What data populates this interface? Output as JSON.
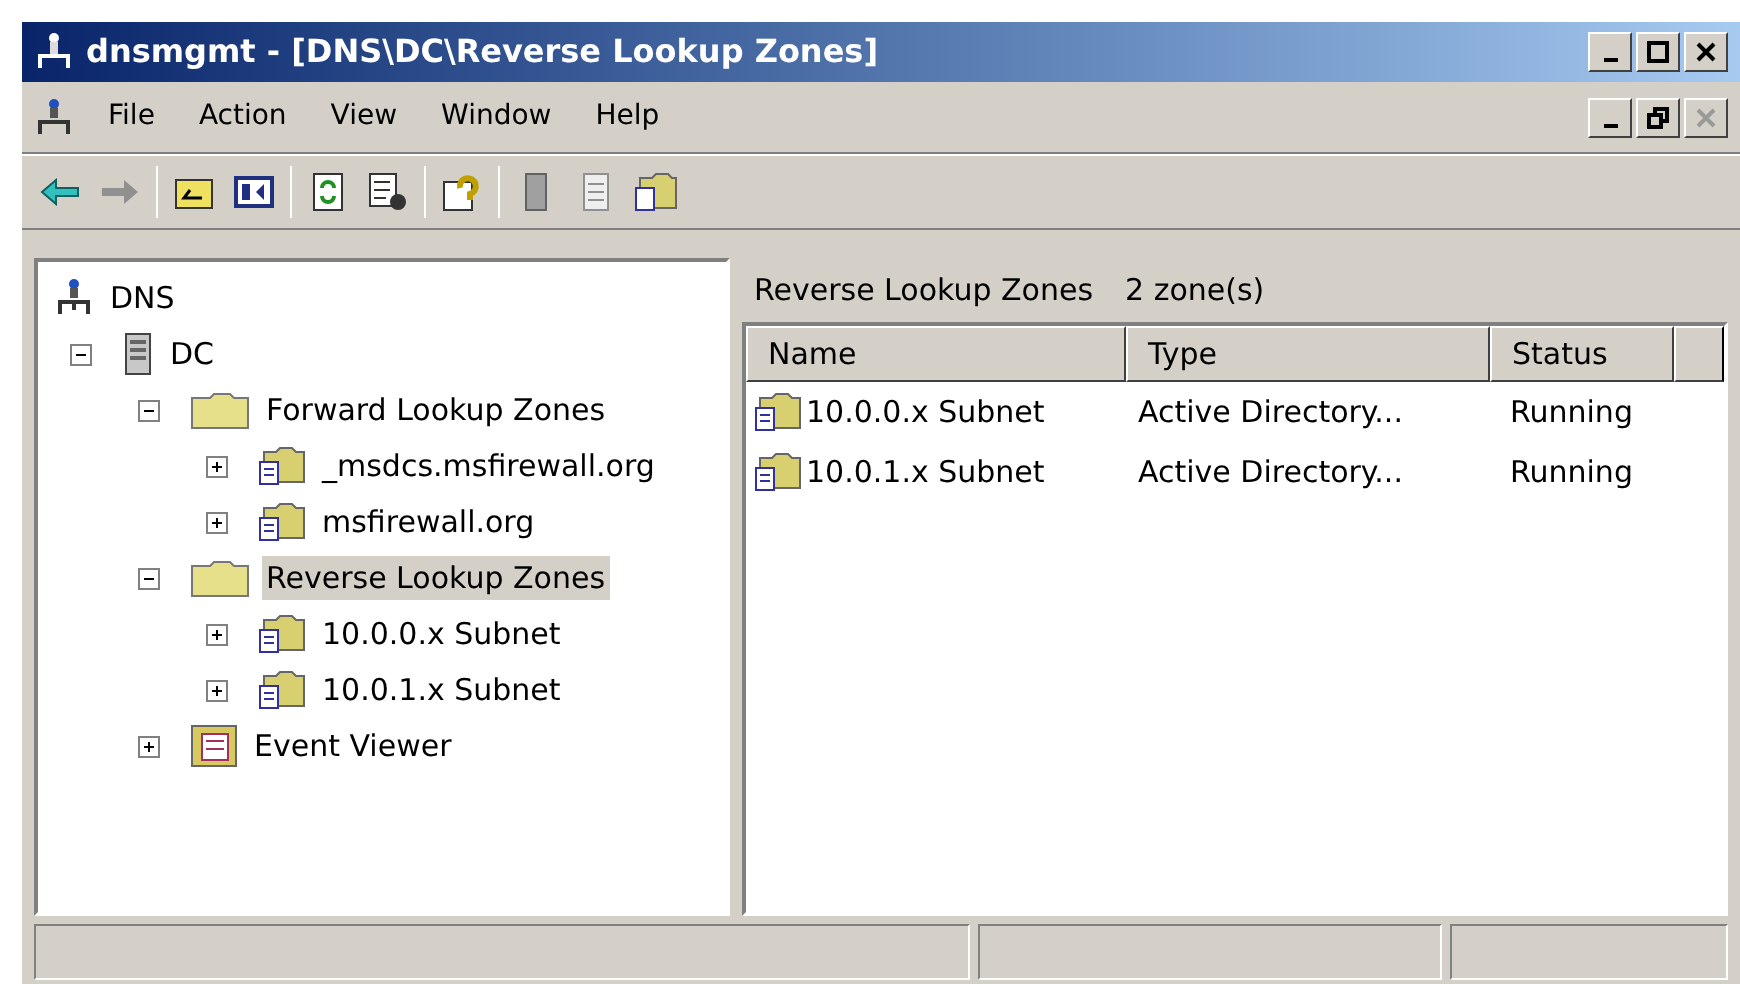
{
  "window": {
    "title": "dnsmgmt - [DNS\\DC\\Reverse Lookup Zones]"
  },
  "menu": [
    "File",
    "Action",
    "View",
    "Window",
    "Help"
  ],
  "tree": [
    {
      "label": "DNS",
      "kind": "network",
      "selected": false,
      "children": [
        {
          "label": "DC",
          "kind": "server",
          "expanded": true,
          "selected": false,
          "children": [
            {
              "label": "Forward Lookup Zones",
              "kind": "folder",
              "expanded": true,
              "selected": false,
              "children": [
                {
                  "label": "_msdcs.msfirewall.org",
                  "kind": "zone",
                  "expanded": false,
                  "selected": false
                },
                {
                  "label": "msfirewall.org",
                  "kind": "zone",
                  "expanded": false,
                  "selected": false
                }
              ]
            },
            {
              "label": "Reverse Lookup Zones",
              "kind": "folder",
              "expanded": true,
              "selected": true,
              "children": [
                {
                  "label": "10.0.0.x Subnet",
                  "kind": "zone",
                  "expanded": false,
                  "selected": false
                },
                {
                  "label": "10.0.1.x Subnet",
                  "kind": "zone",
                  "expanded": false,
                  "selected": false
                }
              ]
            },
            {
              "label": "Event Viewer",
              "kind": "log",
              "expanded": false,
              "selected": false
            }
          ]
        }
      ]
    }
  ],
  "details": {
    "title": "Reverse Lookup Zones",
    "count": "2 zone(s)",
    "columns": [
      "Name",
      "Type",
      "Status"
    ],
    "rows": [
      [
        "10.0.0.x Subnet",
        "Active Directory...",
        "Running"
      ],
      [
        "10.0.1.x Subnet",
        "Active Directory...",
        "Running"
      ]
    ]
  }
}
